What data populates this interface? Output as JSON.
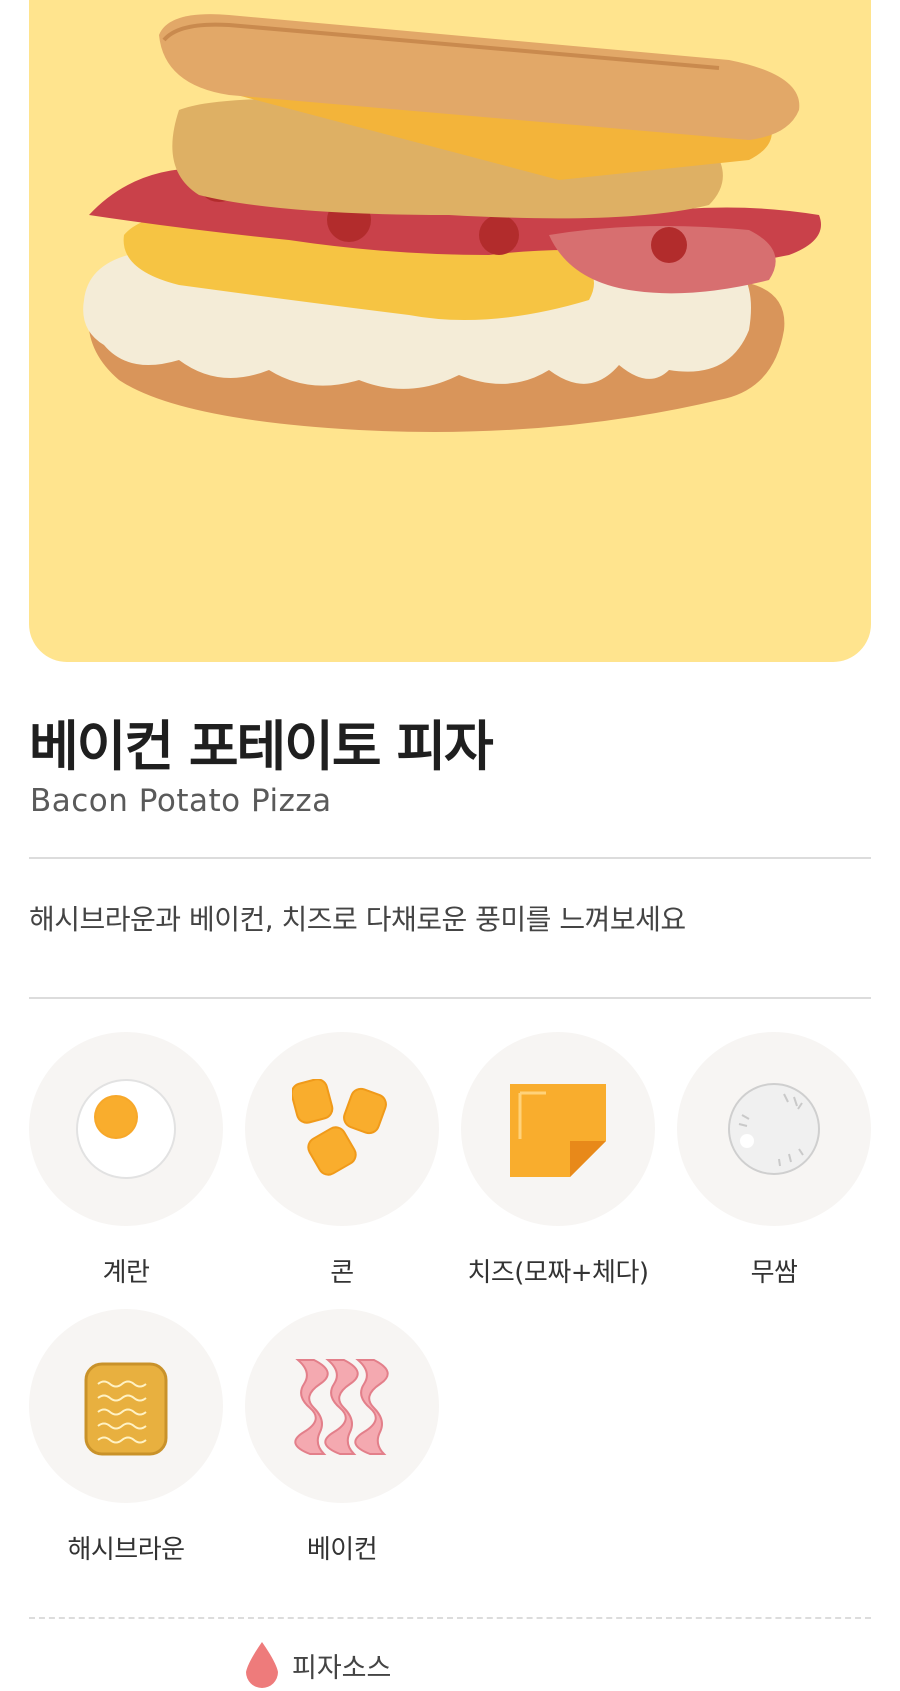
{
  "product": {
    "title": "베이컨 포테이토 피자",
    "subtitle": "Bacon Potato Pizza",
    "description": "해시브라운과 베이컨, 치즈로 다채로운 풍미를 느껴보세요",
    "hero_color": "#ffe48e"
  },
  "ingredients": [
    {
      "label": "계란",
      "icon": "fried-egg-icon"
    },
    {
      "label": "콘",
      "icon": "corn-icon"
    },
    {
      "label": "치즈(모짜+체다)",
      "icon": "cheese-slice-icon"
    },
    {
      "label": "무쌈",
      "icon": "radish-wrap-icon"
    },
    {
      "label": "해시브라운",
      "icon": "hash-brown-icon"
    },
    {
      "label": "베이컨",
      "icon": "bacon-icon"
    }
  ],
  "sauce": {
    "label": "피자소스",
    "icon": "sauce-drop-icon",
    "color": "#ee7b7b"
  }
}
